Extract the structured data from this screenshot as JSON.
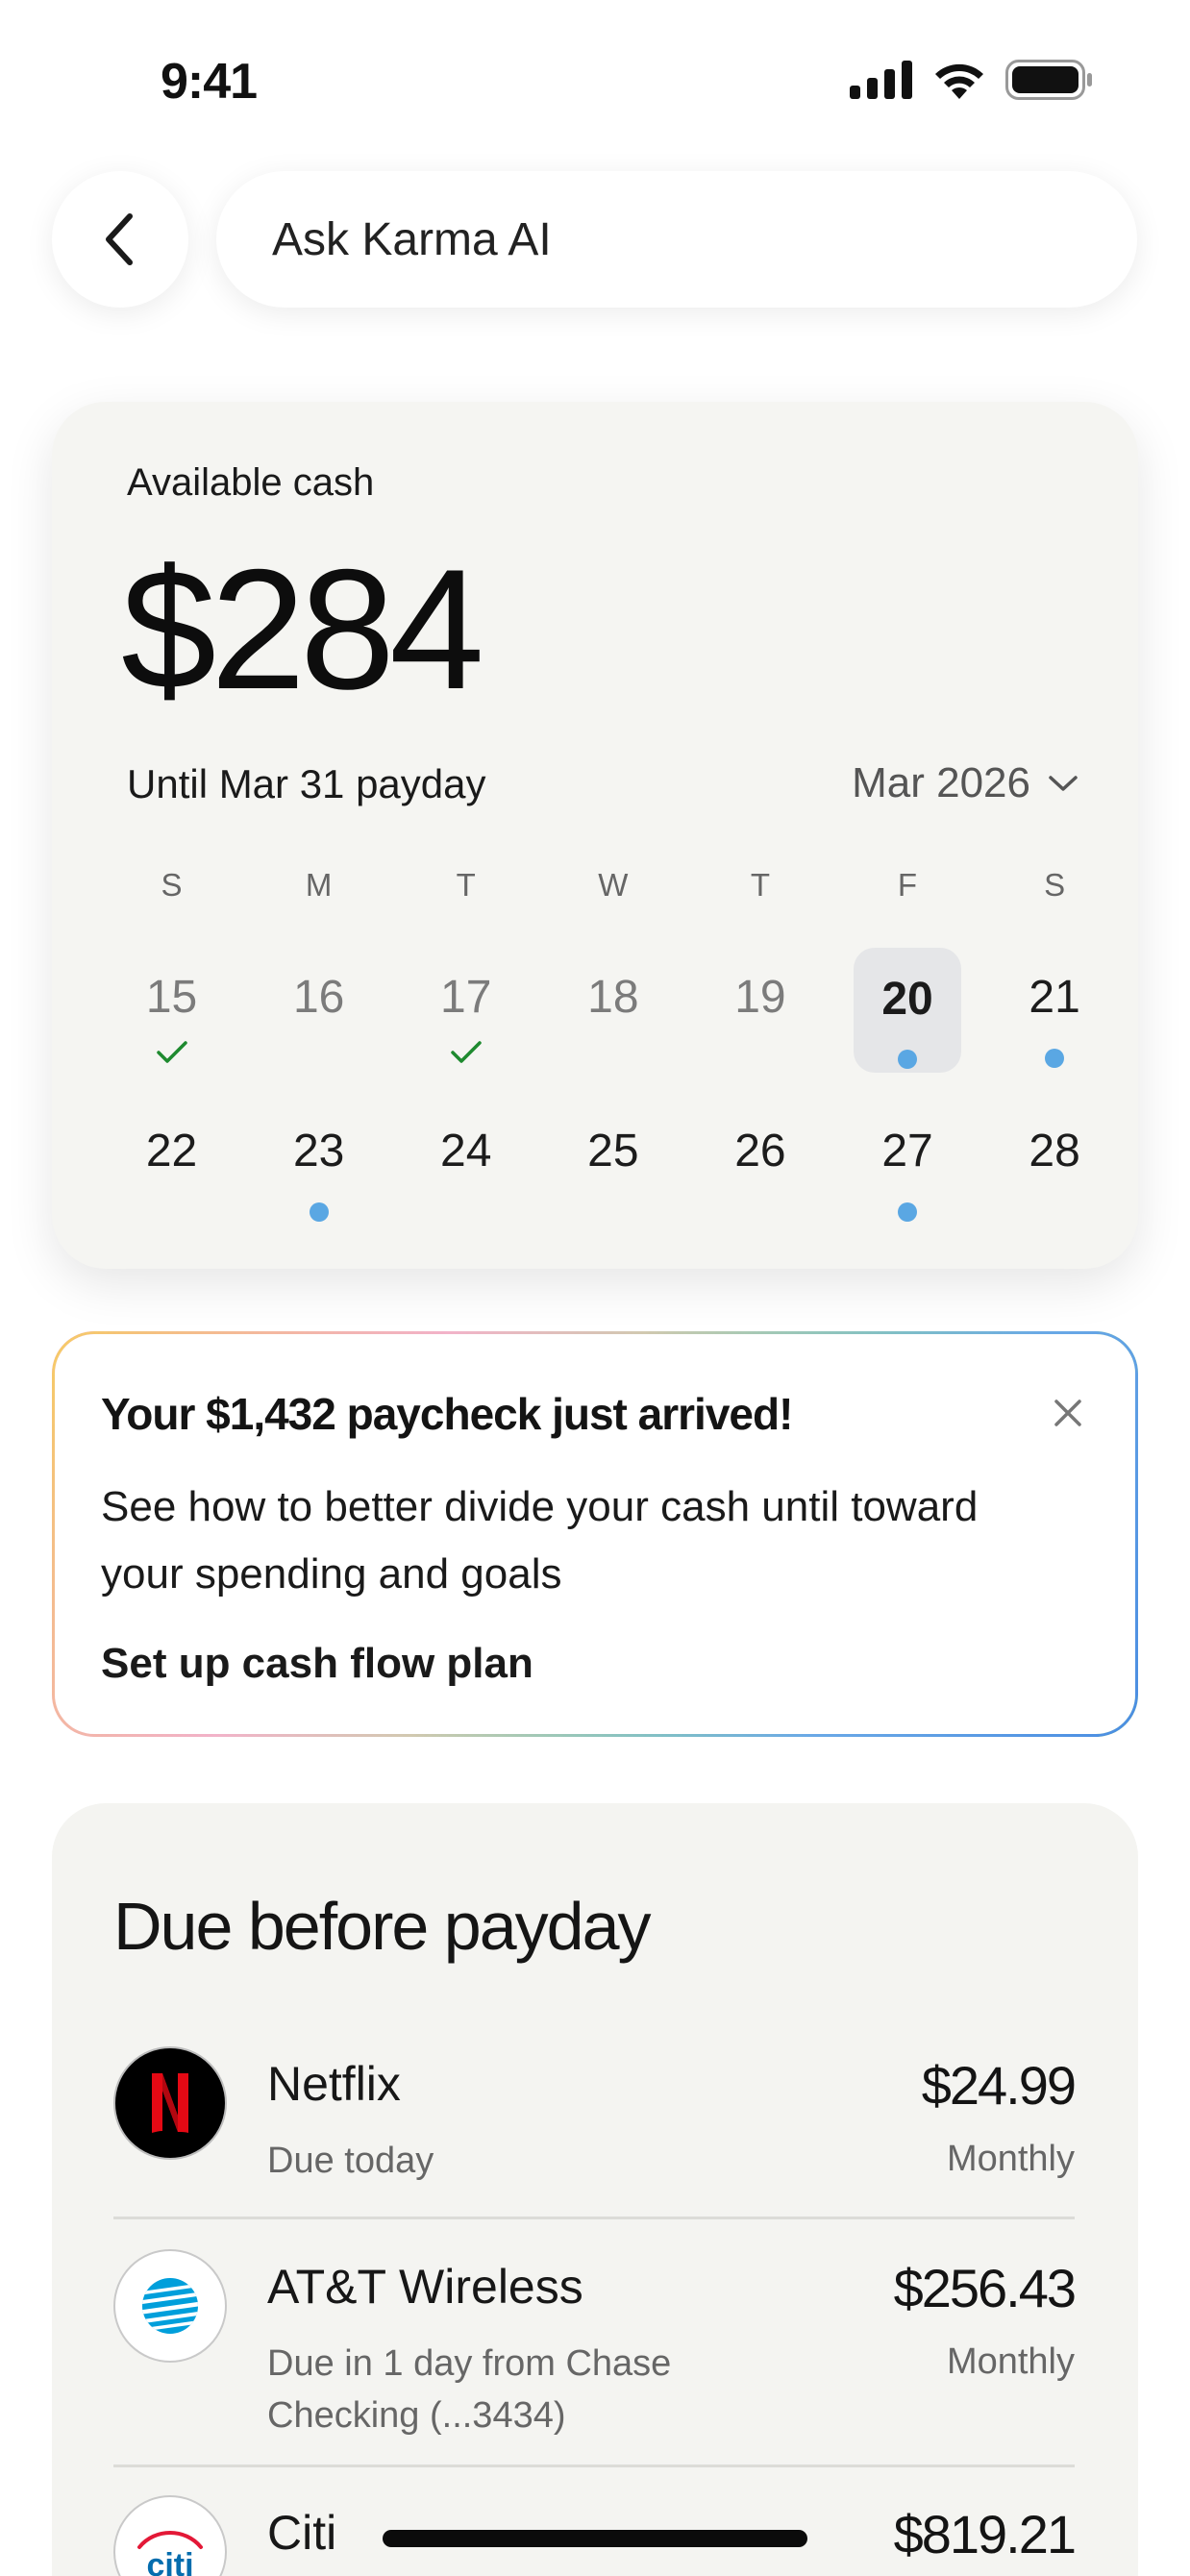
{
  "status_bar": {
    "time": "9:41",
    "icons": [
      "cellular-signal-icon",
      "wifi-icon",
      "battery-icon"
    ]
  },
  "header": {
    "search_label": "Ask Karma AI",
    "back_icon": "chevron-left-icon"
  },
  "cash_card": {
    "label": "Available cash",
    "amount": "$284",
    "until": "Until Mar 31 payday",
    "month": "Mar 2026",
    "weekdays": [
      "S",
      "M",
      "T",
      "W",
      "T",
      "F",
      "S"
    ],
    "weeks": [
      [
        {
          "day": "15",
          "state": "past",
          "mark": "check"
        },
        {
          "day": "16",
          "state": "past",
          "mark": "none"
        },
        {
          "day": "17",
          "state": "past",
          "mark": "check"
        },
        {
          "day": "18",
          "state": "past",
          "mark": "none"
        },
        {
          "day": "19",
          "state": "past",
          "mark": "none"
        },
        {
          "day": "20",
          "state": "today",
          "mark": "dot"
        },
        {
          "day": "21",
          "state": "future",
          "mark": "dot"
        }
      ],
      [
        {
          "day": "22",
          "state": "future",
          "mark": "none"
        },
        {
          "day": "23",
          "state": "future",
          "mark": "dot"
        },
        {
          "day": "24",
          "state": "future",
          "mark": "none"
        },
        {
          "day": "25",
          "state": "future",
          "mark": "none"
        },
        {
          "day": "26",
          "state": "future",
          "mark": "none"
        },
        {
          "day": "27",
          "state": "future",
          "mark": "dot"
        },
        {
          "day": "28",
          "state": "future",
          "mark": "none"
        }
      ]
    ],
    "colors": {
      "check": "#1e8a2f",
      "dot": "#5aa7e3",
      "today_bg": "#e5e6e8"
    }
  },
  "notice": {
    "title": "Your $1,432 paycheck just arrived!",
    "body": "See how to better divide your cash until toward your spending and goals",
    "cta": "Set up cash flow plan"
  },
  "due": {
    "title": "Due before payday",
    "bills": [
      {
        "name": "Netflix",
        "sub": "Due today",
        "amount": "$24.99",
        "frequency": "Monthly",
        "logo": "netflix-logo"
      },
      {
        "name": "AT&T Wireless",
        "sub": "Due in 1 day from Chase Checking (...3434)",
        "amount": "$256.43",
        "frequency": "Monthly",
        "logo": "att-logo"
      },
      {
        "name": "Citi",
        "sub": "",
        "amount": "$819.21",
        "frequency": "",
        "logo": "citi-logo"
      }
    ]
  }
}
